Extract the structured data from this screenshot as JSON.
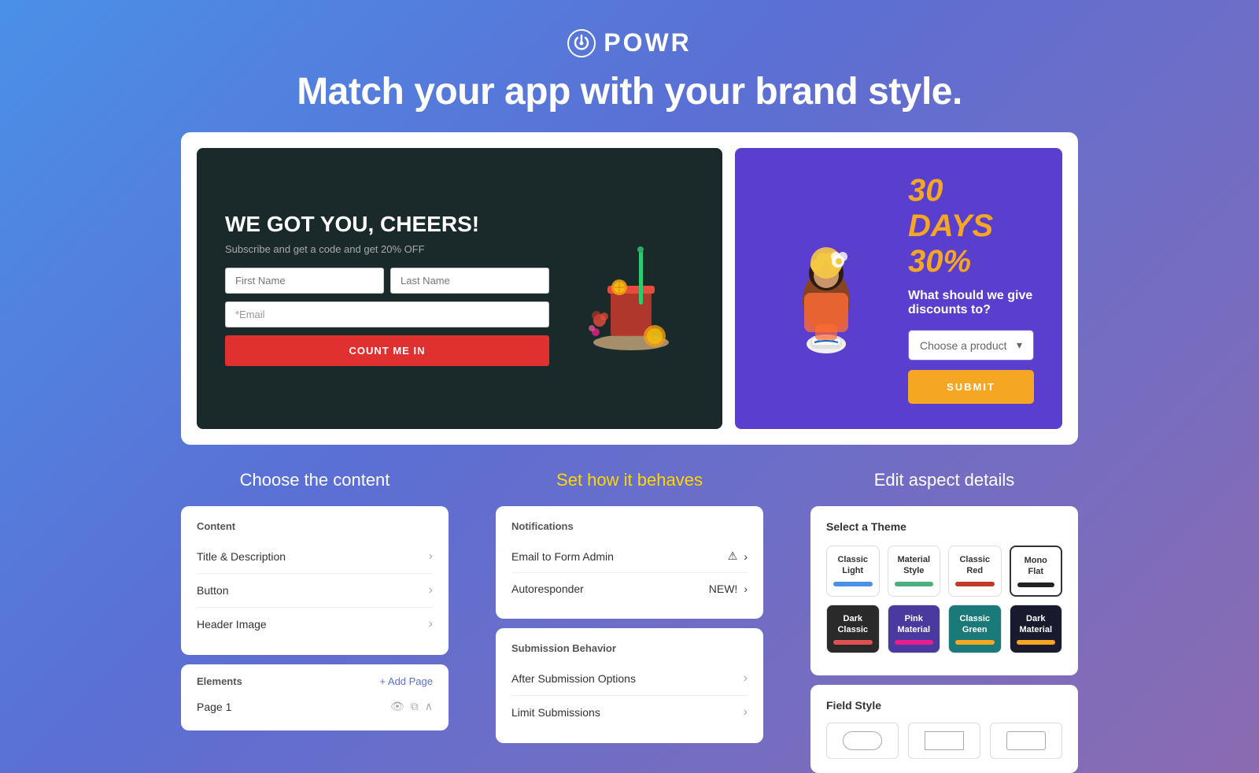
{
  "header": {
    "logo_text": "POWR",
    "headline": "Match your app with your brand style."
  },
  "preview": {
    "left": {
      "title": "WE GOT YOU, CHEERS!",
      "subtitle": "Subscribe and get a code and get 20% OFF",
      "first_name_placeholder": "First Name",
      "last_name_placeholder": "Last Name",
      "email_placeholder": "*Email",
      "submit_label": "COUNT ME IN"
    },
    "right": {
      "title": "30 DAYS 30%",
      "subtitle": "What should we give discounts to?",
      "select_placeholder": "Choose a product",
      "submit_label": "SUBMIT"
    }
  },
  "col1": {
    "title": "Choose the content",
    "content_panel": {
      "header": "Content",
      "items": [
        {
          "label": "Title & Description"
        },
        {
          "label": "Button"
        },
        {
          "label": "Header Image"
        }
      ]
    },
    "elements_panel": {
      "header": "Elements",
      "add_page": "+ Add Page",
      "pages": [
        {
          "label": "Page 1"
        }
      ]
    }
  },
  "col2": {
    "title": "Set how it behaves",
    "notifications_panel": {
      "header": "Notifications",
      "items": [
        {
          "label": "Email to Form Admin",
          "has_warning": true
        },
        {
          "label": "Autoresponder",
          "badge": "NEW!"
        }
      ]
    },
    "submission_panel": {
      "header": "Submission Behavior",
      "items": [
        {
          "label": "After Submission Options"
        },
        {
          "label": "Limit Submissions"
        }
      ]
    }
  },
  "col3": {
    "title": "Edit aspect details",
    "themes_panel": {
      "header": "Select a Theme",
      "themes": [
        {
          "name": "Classic\nLight",
          "bar_color": "#4a90e8",
          "bg": "white"
        },
        {
          "name": "Material\nStyle",
          "bar_color": "#4caf7d",
          "bg": "white"
        },
        {
          "name": "Classic\nRed",
          "bar_color": "#c0392b",
          "bg": "white"
        },
        {
          "name": "Mono\nFlat",
          "bar_color": "#222222",
          "bg": "white",
          "selected": true
        },
        {
          "name": "Dark\nClassic",
          "bar_color": "#e05050",
          "bg": "dark"
        },
        {
          "name": "Pink\nMaterial",
          "bar_color": "#e91e8c",
          "bg": "purple"
        },
        {
          "name": "Classic\nGreen",
          "bar_color": "#f5a623",
          "bg": "teal"
        },
        {
          "name": "Dark\nMaterial",
          "bar_color": "#f5a623",
          "bg": "darkmat"
        }
      ]
    },
    "field_style_panel": {
      "header": "Field Style",
      "options": [
        "rounded",
        "sharp",
        "default"
      ]
    }
  }
}
